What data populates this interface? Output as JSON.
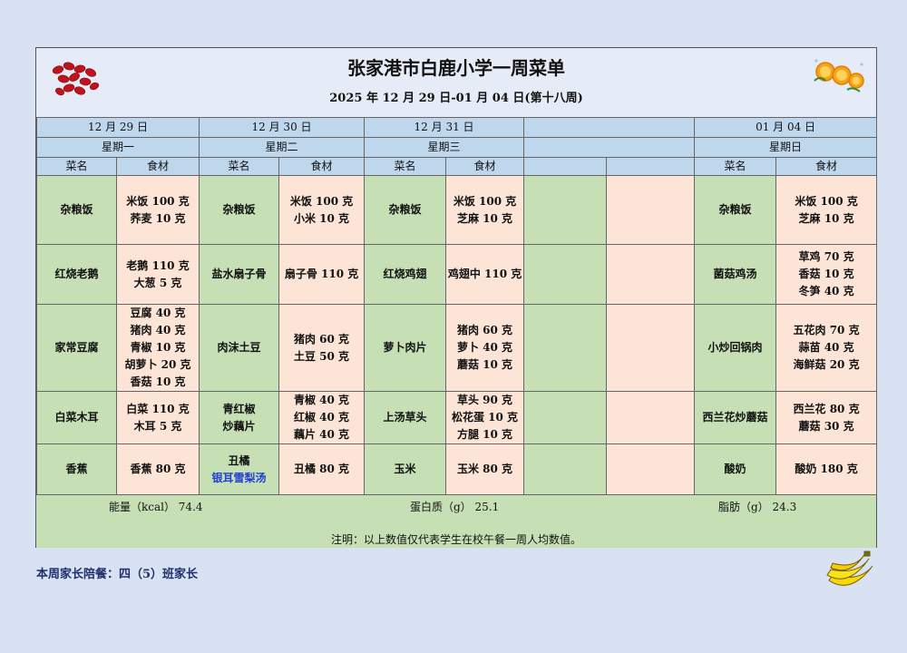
{
  "title": "张家港市白鹿小学一周菜单",
  "subtitle": "2025 年 12 月 29 日-01 月 04 日(第十八周)",
  "days": [
    {
      "date": "12 月 29 日",
      "weekday": "星期一"
    },
    {
      "date": "12 月 30 日",
      "weekday": "星期二"
    },
    {
      "date": "12 月 31 日",
      "weekday": "星期三"
    },
    {
      "date": "",
      "weekday": ""
    },
    {
      "date": "01 月 04 日",
      "weekday": "星期日"
    }
  ],
  "col_labels": {
    "dish": "菜名",
    "ingredients": "食材"
  },
  "rows": [
    [
      {
        "dish": [
          "杂粮饭"
        ],
        "ing": [
          "米饭 100 克",
          "荞麦 10 克"
        ]
      },
      {
        "dish": [
          "杂粮饭"
        ],
        "ing": [
          "米饭 100 克",
          "小米 10 克"
        ]
      },
      {
        "dish": [
          "杂粮饭"
        ],
        "ing": [
          "米饭 100 克",
          "芝麻 10 克"
        ]
      },
      {
        "dish": [],
        "ing": []
      },
      {
        "dish": [
          "杂粮饭"
        ],
        "ing": [
          "米饭 100 克",
          "芝麻 10 克"
        ]
      }
    ],
    [
      {
        "dish": [
          "红烧老鹅"
        ],
        "ing": [
          "老鹅 110 克",
          "大葱 5 克"
        ]
      },
      {
        "dish": [
          "盐水扇子骨"
        ],
        "ing": [
          "扇子骨 110 克"
        ]
      },
      {
        "dish": [
          "红烧鸡翅"
        ],
        "ing": [
          "鸡翅中 110 克"
        ]
      },
      {
        "dish": [],
        "ing": []
      },
      {
        "dish": [
          "菌菇鸡汤"
        ],
        "ing": [
          "草鸡 70 克",
          "香菇 10 克",
          "冬笋 40 克"
        ]
      }
    ],
    [
      {
        "dish": [
          "家常豆腐"
        ],
        "ing": [
          "豆腐 40 克",
          "猪肉 40 克",
          "青椒 10 克",
          "胡萝卜 20 克",
          "香菇 10 克"
        ]
      },
      {
        "dish": [
          "肉沫土豆"
        ],
        "ing": [
          "猪肉 60 克",
          "土豆 50 克"
        ]
      },
      {
        "dish": [
          "萝卜肉片"
        ],
        "ing": [
          "猪肉 60 克",
          "萝卜 40 克",
          "蘑菇 10 克"
        ]
      },
      {
        "dish": [],
        "ing": []
      },
      {
        "dish": [
          "小炒回锅肉"
        ],
        "ing": [
          "五花肉 70 克",
          "蒜苗 40 克",
          "海鲜菇 20 克"
        ]
      }
    ],
    [
      {
        "dish": [
          "白菜木耳"
        ],
        "ing": [
          "白菜 110 克",
          "木耳 5 克"
        ]
      },
      {
        "dish": [
          "青红椒",
          "炒藕片"
        ],
        "ing": [
          "青椒 40 克",
          "红椒 40 克",
          "藕片 40 克"
        ]
      },
      {
        "dish": [
          "上汤草头"
        ],
        "ing": [
          "草头 90 克",
          "松花蛋 10 克",
          "方腿 10 克"
        ]
      },
      {
        "dish": [],
        "ing": []
      },
      {
        "dish": [
          "西兰花炒蘑菇"
        ],
        "ing": [
          "西兰花 80 克",
          "蘑菇 30 克"
        ]
      }
    ],
    [
      {
        "dish": [
          "香蕉"
        ],
        "ing": [
          "香蕉 80 克"
        ]
      },
      {
        "dish": [
          "丑橘",
          "银耳雪梨汤"
        ],
        "ing": [
          "丑橘 80 克"
        ]
      },
      {
        "dish": [
          "玉米"
        ],
        "ing": [
          "玉米 80 克"
        ]
      },
      {
        "dish": [],
        "ing": []
      },
      {
        "dish": [
          "酸奶"
        ],
        "ing": [
          "酸奶 180 克"
        ]
      }
    ]
  ],
  "summary": {
    "energy": "能量（kcal） 74.4",
    "protein": "蛋白质（g） 25.1",
    "fat": "脂肪（g） 24.3",
    "note": "注明：以上数值仅代表学生在校午餐一周人均数值。"
  },
  "footer": "本周家长陪餐：四（5）班家长",
  "colors": {
    "dish_bg": "#c6dfb4",
    "ingredient_bg": "#fce4d6",
    "header_bg": "#bfd7ec",
    "page_bg": "#d9e2f2"
  },
  "icons": [
    "red-beans-icon",
    "orange-slices-icon",
    "banana-icon"
  ]
}
